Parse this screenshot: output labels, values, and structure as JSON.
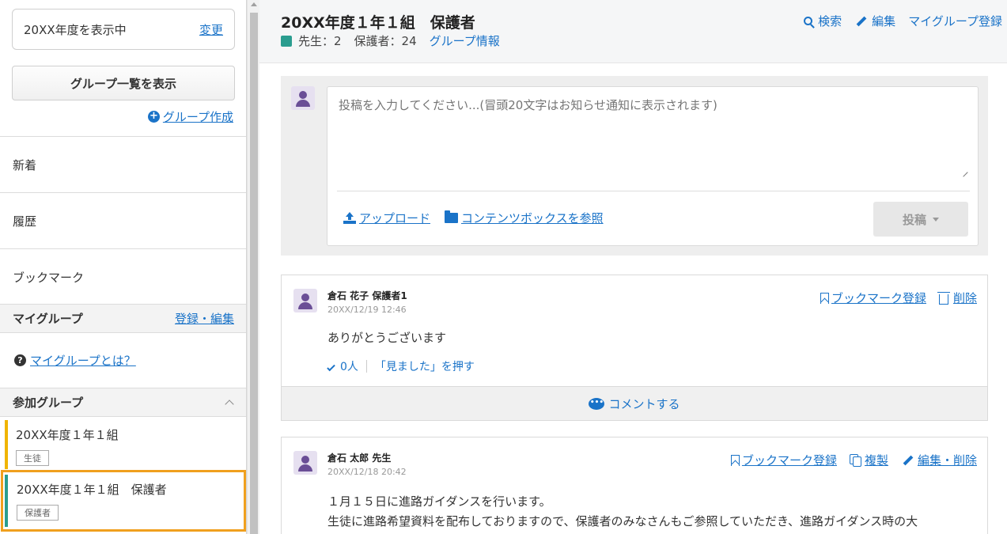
{
  "sidebar": {
    "year_display": "20XX年度を表示中",
    "change_link": "変更",
    "group_list_button": "グループ一覧を表示",
    "create_group_link": "グループ作成",
    "nav": [
      "新着",
      "履歴",
      "ブックマーク"
    ],
    "my_group": {
      "heading": "マイグループ",
      "edit_link": "登録・編集",
      "help_link": "マイグループとは？"
    },
    "joined_groups": {
      "heading": "参加グループ",
      "items": [
        {
          "name": "20XX年度１年１組",
          "tag": "生徒",
          "bar_color": "#f0b400"
        },
        {
          "name": "20XX年度１年１組　保護者",
          "tag": "保護者",
          "bar_color": "#2a9d8f"
        }
      ]
    }
  },
  "header": {
    "title": "20XX年度１年１組　保護者",
    "teachers": "先生：2",
    "guardians": "保護者：24",
    "group_info_link": "グループ情報",
    "actions": {
      "search": "検索",
      "edit": "編集",
      "my_group_register": "マイグループ登録"
    }
  },
  "composer": {
    "placeholder": "投稿を入力してください...(冒頭20文字はお知らせ通知に表示されます)",
    "upload": "アップロード",
    "contents_box": "コンテンツボックスを参照",
    "post_button": "投稿"
  },
  "posts": [
    {
      "author": "倉石 花子 保護者1",
      "time": "20XX/12/19 12:46",
      "body": "ありがとうございます",
      "seen_count": "0人",
      "seen_button": "「見ました」を押す",
      "bookmark": "ブックマーク登録",
      "delete": "削除",
      "comment": "コメントする"
    },
    {
      "author": "倉石 太郎 先生",
      "time": "20XX/12/18 20:42",
      "body_line1": "１月１５日に進路ガイダンスを行います。",
      "body_line2": "生徒に進路希望資料を配布しておりますので、保護者のみなさんもご参照していただき、進路ガイダンス時の大",
      "bookmark": "ブックマーク登録",
      "copy": "複製",
      "edit_delete": "編集・削除"
    }
  ],
  "colors": {
    "accent": "#1a73c8",
    "selected_border": "#f0a01e",
    "group_square": "#2a9d8f"
  }
}
